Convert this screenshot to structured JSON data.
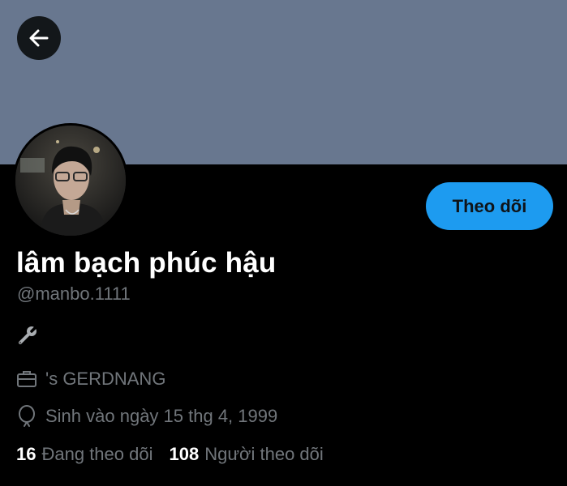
{
  "colors": {
    "banner": "#68778f",
    "accent": "#1d9bf0",
    "background": "#000000",
    "secondary_text": "#71767b"
  },
  "header": {
    "back_icon": "arrow-left-icon"
  },
  "profile": {
    "name": "lâm bạch phúc hậu",
    "handle": "@manbo.1111",
    "bio_icon": "wrench-icon",
    "work": "'s GERDNANG",
    "birthday": "Sinh vào ngày 15 thg 4, 1999",
    "follow_label": "Theo dõi"
  },
  "stats": {
    "following_count": "16",
    "following_label": "Đang theo dõi",
    "followers_count": "108",
    "followers_label": "Người theo dõi"
  }
}
